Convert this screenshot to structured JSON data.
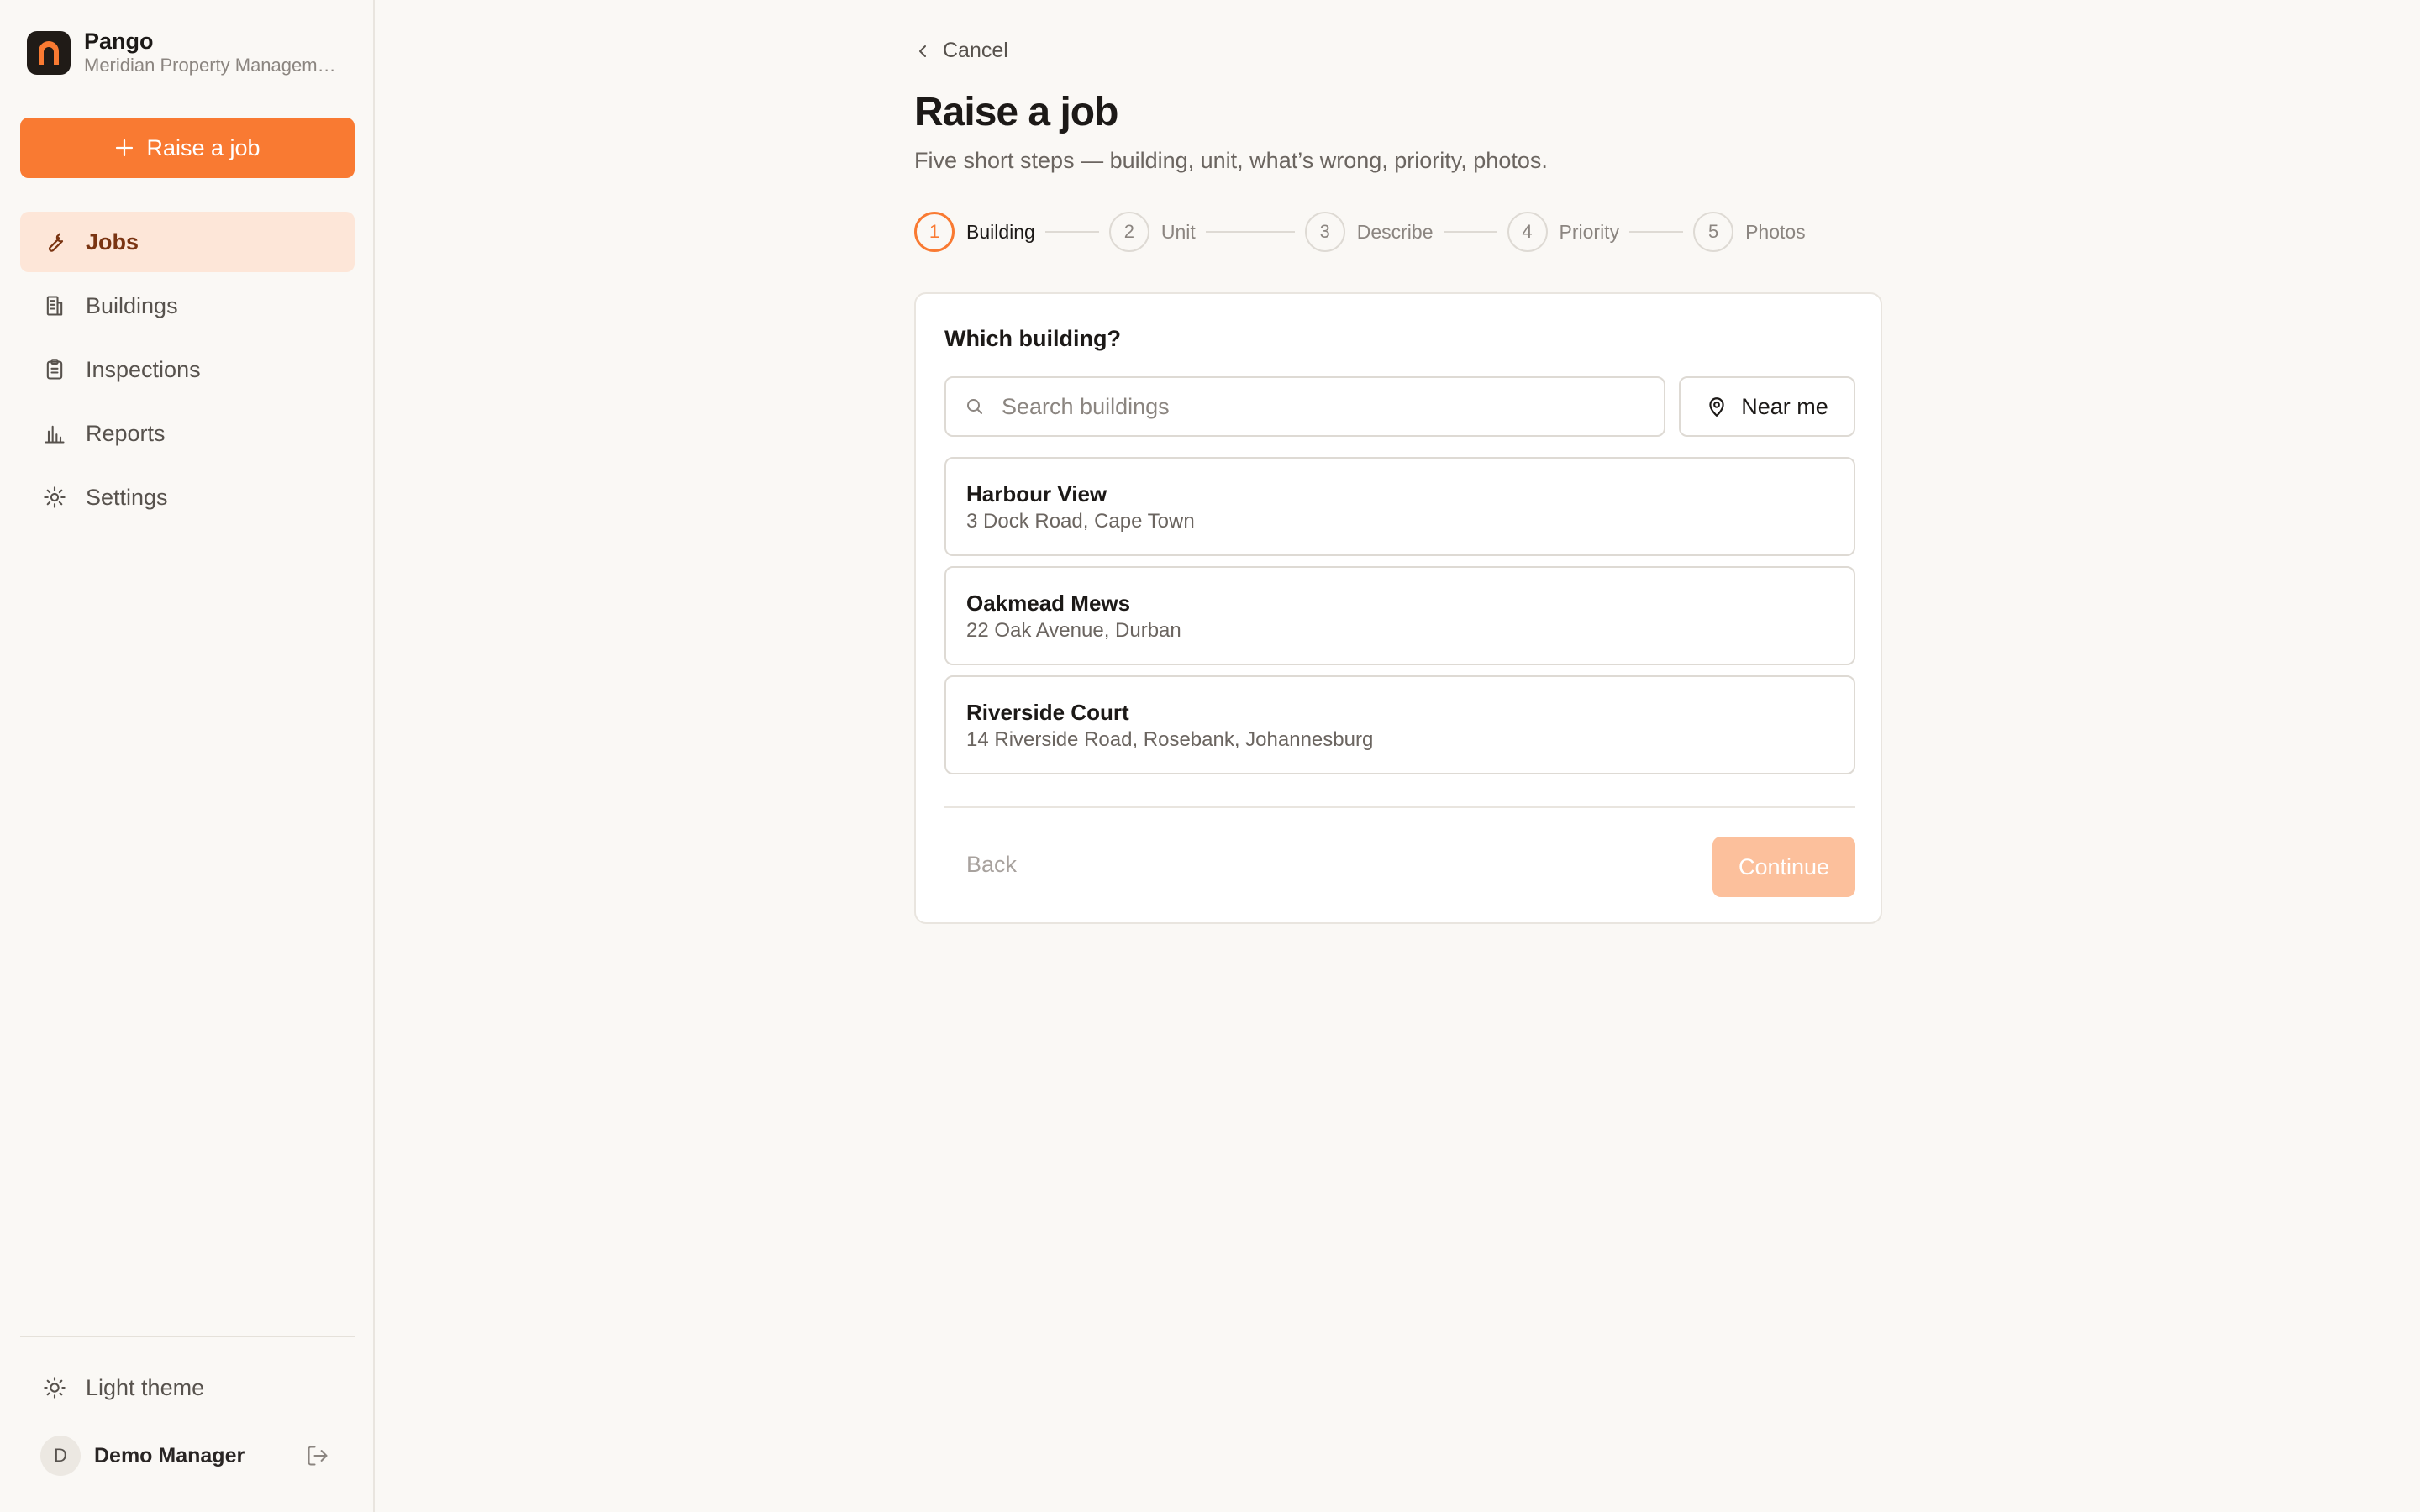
{
  "brand": {
    "name": "Pango",
    "org": "Meridian Property Management",
    "accent": "#f97a32"
  },
  "sidebar": {
    "raise_button": "Raise a job",
    "items": [
      {
        "label": "Jobs",
        "icon": "wrench-icon",
        "active": true
      },
      {
        "label": "Buildings",
        "icon": "building-icon",
        "active": false
      },
      {
        "label": "Inspections",
        "icon": "clipboard-icon",
        "active": false
      },
      {
        "label": "Reports",
        "icon": "bar-chart-icon",
        "active": false
      },
      {
        "label": "Settings",
        "icon": "gear-icon",
        "active": false
      }
    ],
    "theme_label": "Light theme",
    "user": {
      "initial": "D",
      "name": "Demo Manager"
    }
  },
  "page": {
    "cancel_label": "Cancel",
    "title": "Raise a job",
    "subtitle": "Five short steps — building, unit, what’s wrong, priority, photos.",
    "steps": [
      {
        "number": "1",
        "label": "Building",
        "active": true
      },
      {
        "number": "2",
        "label": "Unit",
        "active": false
      },
      {
        "number": "3",
        "label": "Describe",
        "active": false
      },
      {
        "number": "4",
        "label": "Priority",
        "active": false
      },
      {
        "number": "5",
        "label": "Photos",
        "active": false
      }
    ]
  },
  "card": {
    "question": "Which building?",
    "search_placeholder": "Search buildings",
    "near_me_label": "Near me",
    "buildings": [
      {
        "name": "Harbour View",
        "address": "3 Dock Road, Cape Town"
      },
      {
        "name": "Oakmead Mews",
        "address": "22 Oak Avenue, Durban"
      },
      {
        "name": "Riverside Court",
        "address": "14 Riverside Road, Rosebank, Johannesburg"
      }
    ],
    "back_label": "Back",
    "continue_label": "Continue"
  }
}
